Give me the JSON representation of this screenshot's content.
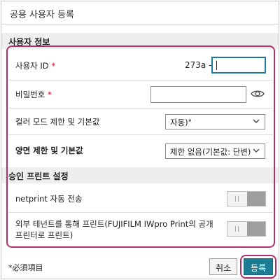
{
  "dialog": {
    "title": "공용 사용자 등록"
  },
  "user_info": {
    "section_title": "사용자 정보",
    "user_id": {
      "label": "사용자 ID",
      "required_mark": "*",
      "prefix": "273a -",
      "value": ""
    },
    "password": {
      "label": "비밀번호",
      "required_mark": "*",
      "value": "",
      "show_icon": "eye-icon"
    },
    "color_mode": {
      "label": "컬러 모드 제한 및 기본값",
      "selected": "자동)\""
    },
    "duplex": {
      "label": "양면 제한 및 기본값",
      "selected": "제한 없음(기본값: 단변)"
    }
  },
  "approval_print": {
    "section_title": "승인 프린트 설정",
    "netprint": {
      "label": "netprint 자동 전송",
      "state": "off"
    },
    "external_tenant": {
      "label_line1": "외부 테넌트를 통해 프린트(FUJIFILM IWpro Print의 공개",
      "label_line2": "프린터로 프린트)",
      "state": "off"
    }
  },
  "footer": {
    "required_note": "*必須項目",
    "cancel_label": "취소",
    "register_label": "등록"
  },
  "colors": {
    "accent": "#1b7c94",
    "highlight": "#b0306a",
    "required": "#d0021b"
  }
}
